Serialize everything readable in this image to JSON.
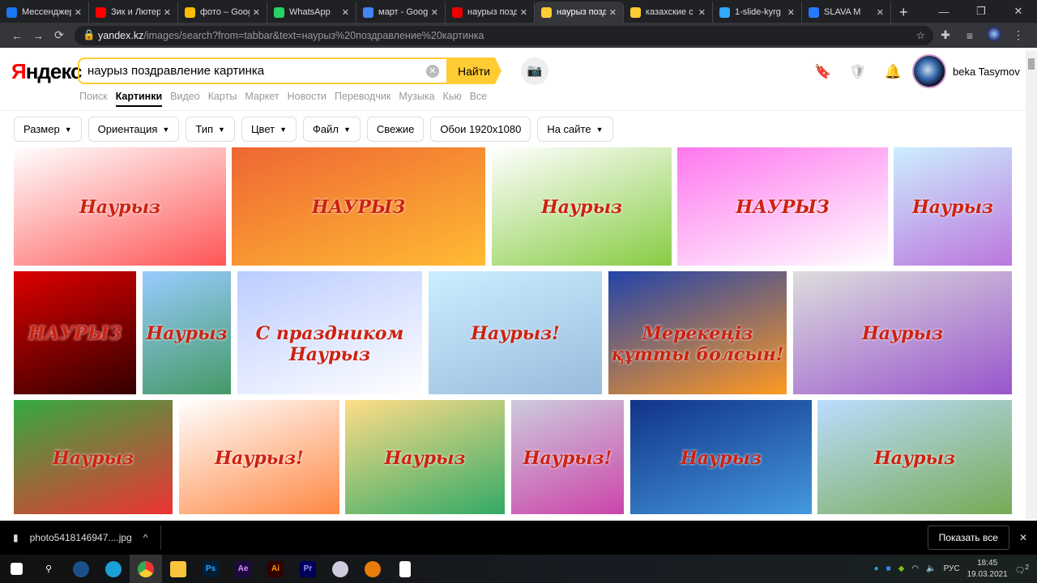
{
  "tabs": [
    {
      "title": "Мессенджер",
      "color": "#1877f2",
      "active": false
    },
    {
      "title": "Зик и Лютер",
      "color": "#f00",
      "active": false
    },
    {
      "title": "фото – Google",
      "color": "#fbbc04",
      "active": false
    },
    {
      "title": "WhatsApp",
      "color": "#25d366",
      "active": false
    },
    {
      "title": "март - Google",
      "color": "#4285f4",
      "active": false
    },
    {
      "title": "наурыз позд",
      "color": "#e00",
      "active": false
    },
    {
      "title": "наурыз позд",
      "color": "#fc3",
      "active": true
    },
    {
      "title": "казахские с",
      "color": "#fc3",
      "active": false
    },
    {
      "title": "1-slide-kyrg",
      "color": "#3af",
      "active": false
    },
    {
      "title": "SLAVA M",
      "color": "#2979ff",
      "active": false
    }
  ],
  "address": {
    "domain": "yandex.kz",
    "path": "/images/search?from=tabbar&text=наурыз%20поздравление%20картинка"
  },
  "yandex": {
    "logo_first": "Я",
    "logo_rest": "ндекс",
    "query": "наурыз поздравление картинка",
    "find": "Найти",
    "user": "beka Tasymov"
  },
  "services": [
    "Поиск",
    "Картинки",
    "Видео",
    "Карты",
    "Маркет",
    "Новости",
    "Переводчик",
    "Музыка",
    "Кью",
    "Все"
  ],
  "filters": [
    {
      "label": "Размер",
      "dropdown": true
    },
    {
      "label": "Ориентация",
      "dropdown": true
    },
    {
      "label": "Тип",
      "dropdown": true
    },
    {
      "label": "Цвет",
      "dropdown": true
    },
    {
      "label": "Файл",
      "dropdown": true
    },
    {
      "label": "Свежие",
      "dropdown": false
    },
    {
      "label": "Обои 1920x1080",
      "dropdown": false
    },
    {
      "label": "На сайте",
      "dropdown": true
    }
  ],
  "images": [
    {
      "caption": "Наурыз",
      "colors": [
        "#fff",
        "#f55"
      ]
    },
    {
      "caption": "НАУРЫЗ",
      "colors": [
        "#e63",
        "#fb3"
      ]
    },
    {
      "caption": "Наурыз",
      "colors": [
        "#fff",
        "#8c4"
      ]
    },
    {
      "caption": "НАУРЫЗ",
      "colors": [
        "#f7e",
        "#fff"
      ]
    },
    {
      "caption": "Наурыз",
      "colors": [
        "#cef",
        "#b7d"
      ]
    },
    {
      "caption": "НАУРЫЗ",
      "colors": [
        "#d00",
        "#300"
      ]
    },
    {
      "caption": "Наурыз",
      "colors": [
        "#9cf",
        "#496"
      ]
    },
    {
      "caption": "С праздником Наурыз",
      "colors": [
        "#bcf",
        "#fff"
      ]
    },
    {
      "caption": "Наурыз!",
      "colors": [
        "#cef",
        "#9bd"
      ]
    },
    {
      "caption": "Мерекеңіз құтты болсын!",
      "colors": [
        "#24a",
        "#f92"
      ]
    },
    {
      "caption": "Наурыз",
      "colors": [
        "#ddd",
        "#95c"
      ]
    },
    {
      "caption": "Наурыз",
      "colors": [
        "#3a4",
        "#e33"
      ]
    },
    {
      "caption": "Наурыз!",
      "colors": [
        "#fff",
        "#f84"
      ]
    },
    {
      "caption": "Наурыз",
      "colors": [
        "#fd8",
        "#3a6"
      ]
    },
    {
      "caption": "Наурыз!",
      "colors": [
        "#ccd",
        "#c4a"
      ]
    },
    {
      "caption": "Наурыз",
      "colors": [
        "#138",
        "#49d"
      ]
    },
    {
      "caption": "Наурыз",
      "colors": [
        "#bdf",
        "#7a5"
      ]
    }
  ],
  "download": {
    "file": "photo5418146947....jpg",
    "show_all": "Показать все"
  },
  "taskbar": {
    "lang": "РУС",
    "time": "18:45",
    "date": "19.03.2021",
    "notifications": "2"
  }
}
